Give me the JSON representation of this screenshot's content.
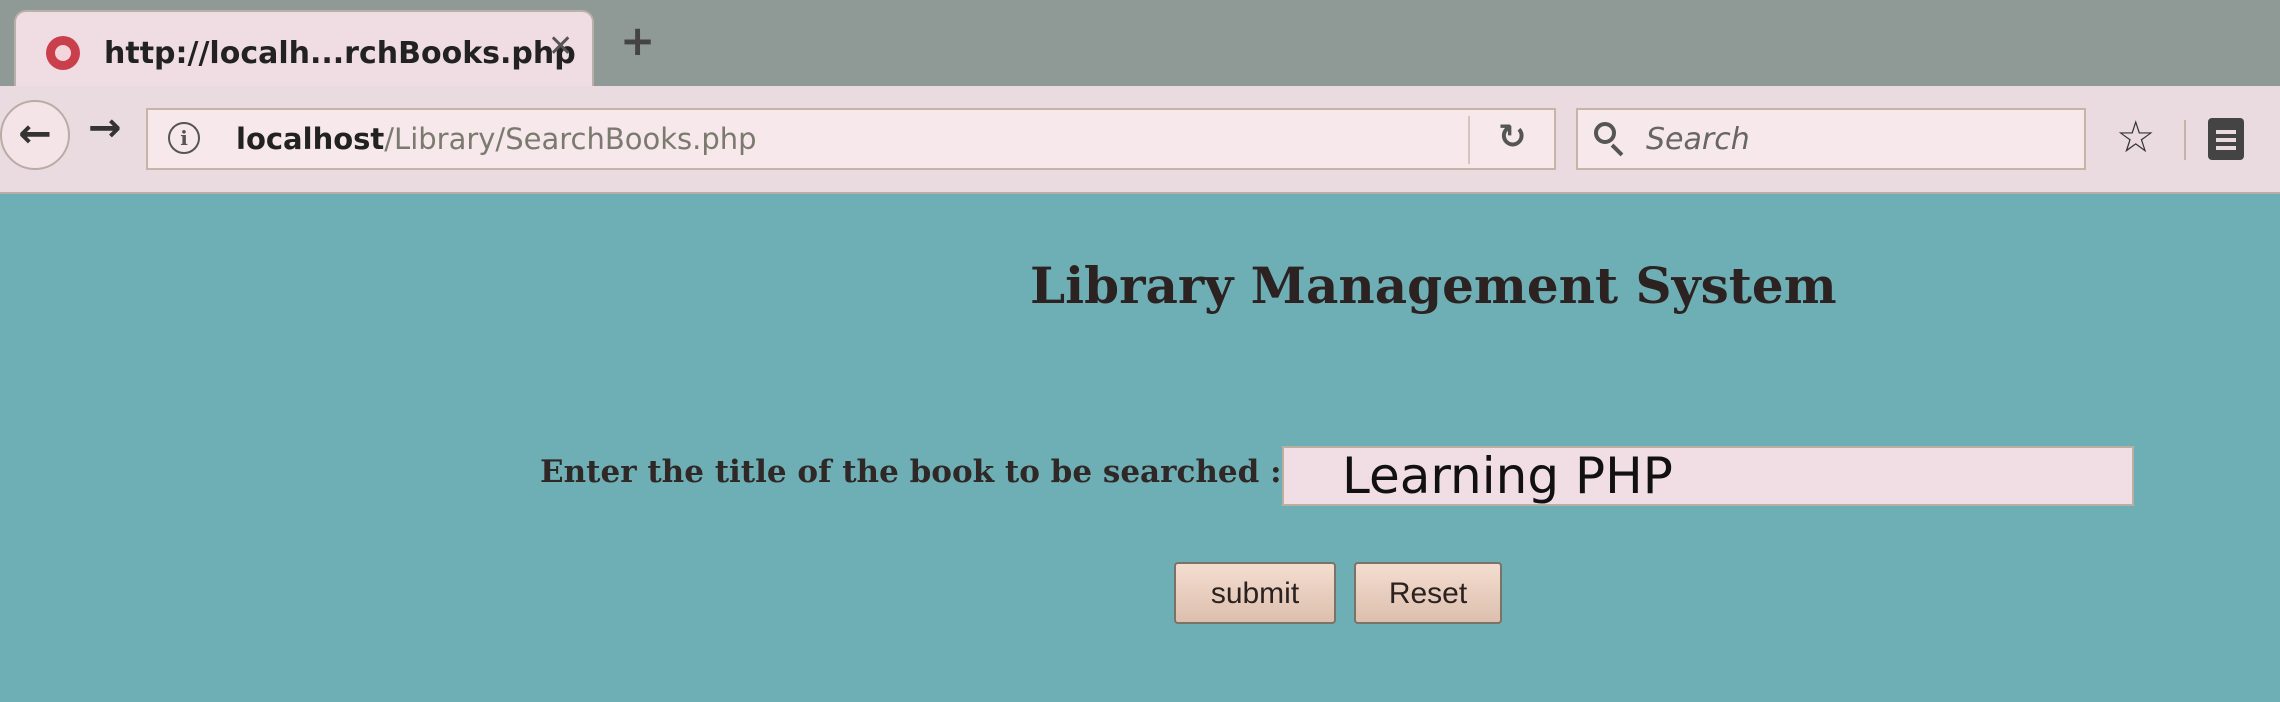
{
  "browser": {
    "tab": {
      "title": "http://localh...rchBooks.php",
      "close_glyph": "✕",
      "favicon": "site-favicon-icon"
    },
    "new_tab_glyph": "+",
    "nav": {
      "back_glyph": "🡐",
      "forward_glyph": "🡒",
      "info_glyph": "i",
      "url_host": "localhost",
      "url_path": "/Library/SearchBooks.php",
      "reload_glyph": "C",
      "search_placeholder": "Search",
      "star_glyph": "☆"
    }
  },
  "page": {
    "title": "Library Management System",
    "search_label": "Enter the title of the book to be searched :",
    "search_value": "Learning PHP",
    "submit_label": "submit",
    "reset_label": "Reset"
  },
  "colors": {
    "page_background": "#6fb0b6",
    "chrome_background": "#eadbe0",
    "input_background": "#f1dde4"
  }
}
